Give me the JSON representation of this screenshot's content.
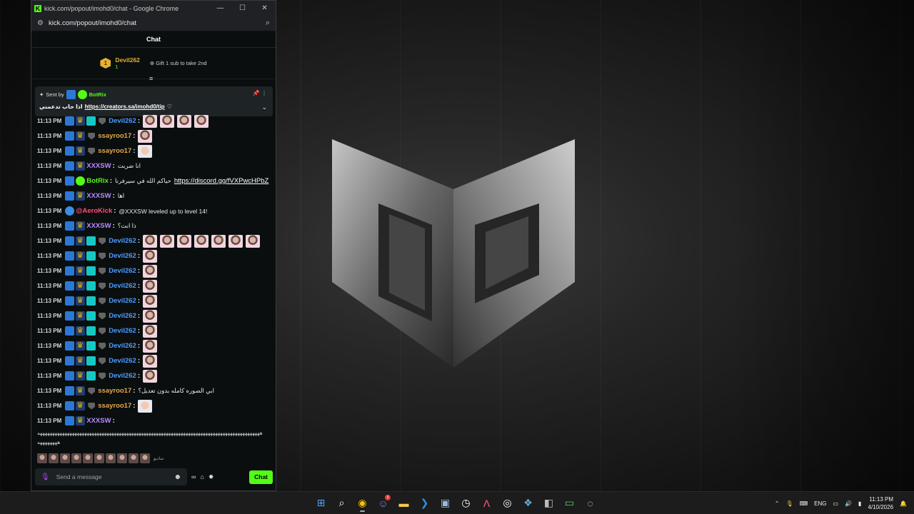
{
  "window": {
    "title": "kick.com/popout/imohd0/chat - Google Chrome",
    "url": "kick.com/popout/imohd0/chat",
    "min": "—",
    "max": "☐",
    "close": "✕"
  },
  "chat": {
    "header": "Chat",
    "leader": {
      "rank": "1",
      "name": "Devil262",
      "count": "1",
      "gift_text": "Gift 1 sub to take 2nd"
    },
    "pinned": {
      "sent_by": "Sent by",
      "bot": "BotRix",
      "text": "اذا حاب تدعمني",
      "link": "https://creators.sa/imohd0/tip"
    },
    "messages": [
      {
        "time": "11:13 PM",
        "user": "Devil262",
        "color": "#4a9cff",
        "badges": [
          "blue",
          "crown",
          "teal",
          "shield"
        ],
        "text": "",
        "emotes": 4
      },
      {
        "time": "11:13 PM",
        "user": "ssayroo17",
        "color": "#e4a84b",
        "badges": [
          "blue",
          "crown",
          "shield"
        ],
        "text": "",
        "emotes": 1,
        "emote_style": "plain"
      },
      {
        "time": "11:13 PM",
        "user": "ssayroo17",
        "color": "#e4a84b",
        "badges": [
          "blue",
          "crown",
          "shield"
        ],
        "text": "",
        "emotes": 1,
        "emote_style": "face"
      },
      {
        "time": "11:13 PM",
        "user": "XXXSW",
        "color": "#b58cff",
        "badges": [
          "blue",
          "crown"
        ],
        "text": "انا ضربت",
        "emotes": 0
      },
      {
        "time": "11:13 PM",
        "user": "BotRix",
        "color": "#53fc18",
        "badges": [
          "blue",
          "bot"
        ],
        "text": "حياكم الله في سيرفرنا",
        "link": "https://discord.gg/fVXPwcHPbZ",
        "emotes": 0
      },
      {
        "time": "11:13 PM",
        "user": "XXXSW",
        "color": "#b58cff",
        "badges": [
          "blue",
          "crown"
        ],
        "text": "اها",
        "emotes": 0
      },
      {
        "time": "11:13 PM",
        "user": "@AeroKick",
        "color": "#ff4f7b",
        "badges": [
          "aero"
        ],
        "text": "@XXXSW leveled up to level 14!",
        "emotes": 0
      },
      {
        "time": "11:13 PM",
        "user": "XXXSW",
        "color": "#b58cff",
        "badges": [
          "blue",
          "crown"
        ],
        "text": "ذا انت؟",
        "emotes": 0
      },
      {
        "time": "11:13 PM",
        "user": "Devil262",
        "color": "#4a9cff",
        "badges": [
          "blue",
          "crown",
          "teal",
          "shield"
        ],
        "text": "",
        "emotes": 7
      },
      {
        "time": "11:13 PM",
        "user": "Devil262",
        "color": "#4a9cff",
        "badges": [
          "blue",
          "crown",
          "teal",
          "shield"
        ],
        "text": "",
        "emotes": 1
      },
      {
        "time": "11:13 PM",
        "user": "Devil262",
        "color": "#4a9cff",
        "badges": [
          "blue",
          "crown",
          "teal",
          "shield"
        ],
        "text": "",
        "emotes": 1
      },
      {
        "time": "11:13 PM",
        "user": "Devil262",
        "color": "#4a9cff",
        "badges": [
          "blue",
          "crown",
          "teal",
          "shield"
        ],
        "text": "",
        "emotes": 1
      },
      {
        "time": "11:13 PM",
        "user": "Devil262",
        "color": "#4a9cff",
        "badges": [
          "blue",
          "crown",
          "teal",
          "shield"
        ],
        "text": "",
        "emotes": 1
      },
      {
        "time": "11:13 PM",
        "user": "Devil262",
        "color": "#4a9cff",
        "badges": [
          "blue",
          "crown",
          "teal",
          "shield"
        ],
        "text": "",
        "emotes": 1
      },
      {
        "time": "11:13 PM",
        "user": "Devil262",
        "color": "#4a9cff",
        "badges": [
          "blue",
          "crown",
          "teal",
          "shield"
        ],
        "text": "",
        "emotes": 1
      },
      {
        "time": "11:13 PM",
        "user": "Devil262",
        "color": "#4a9cff",
        "badges": [
          "blue",
          "crown",
          "teal",
          "shield"
        ],
        "text": "",
        "emotes": 1
      },
      {
        "time": "11:13 PM",
        "user": "Devil262",
        "color": "#4a9cff",
        "badges": [
          "blue",
          "crown",
          "teal",
          "shield"
        ],
        "text": "",
        "emotes": 1
      },
      {
        "time": "11:13 PM",
        "user": "Devil262",
        "color": "#4a9cff",
        "badges": [
          "blue",
          "crown",
          "teal",
          "shield"
        ],
        "text": "",
        "emotes": 1
      },
      {
        "time": "11:13 PM",
        "user": "ssayroo17",
        "color": "#e4a84b",
        "badges": [
          "blue",
          "crown",
          "shield"
        ],
        "text": "ابي الصوره كامله بدون تعديل؟",
        "emotes": 0
      },
      {
        "time": "11:13 PM",
        "user": "ssayroo17",
        "color": "#e4a84b",
        "badges": [
          "blue",
          "crown",
          "shield"
        ],
        "text": "",
        "emotes": 1,
        "emote_style": "face"
      },
      {
        "time": "11:13 PM",
        "user": "XXXSW",
        "color": "#b58cff",
        "badges": [
          "blue",
          "crown"
        ],
        "text": "",
        "emotes": 0
      }
    ],
    "wrapped_line_1": "ههههههههههههههههههههههههههههههههههههههههههههههههههههههههههههههههههههههههههههههههههههههههههه",
    "wrapped_line_2": "ههههههههه",
    "emote_bar_label": "ساديو",
    "composer": {
      "placeholder": "Send a message",
      "send_label": "Chat"
    }
  },
  "taskbar": {
    "apps": [
      "start-icon",
      "search-icon",
      "chrome-icon",
      "discord-icon",
      "file-explorer-icon",
      "vscode-icon",
      "app-icon",
      "clock-app-icon",
      "app-a-icon",
      "obs-icon",
      "app-icon-2",
      "app-icon-3",
      "app-icon-4",
      "app-icon-5"
    ],
    "discord_badge": "9",
    "lang": "ENG",
    "time": "11:13 PM",
    "date": "4/10/2026"
  }
}
